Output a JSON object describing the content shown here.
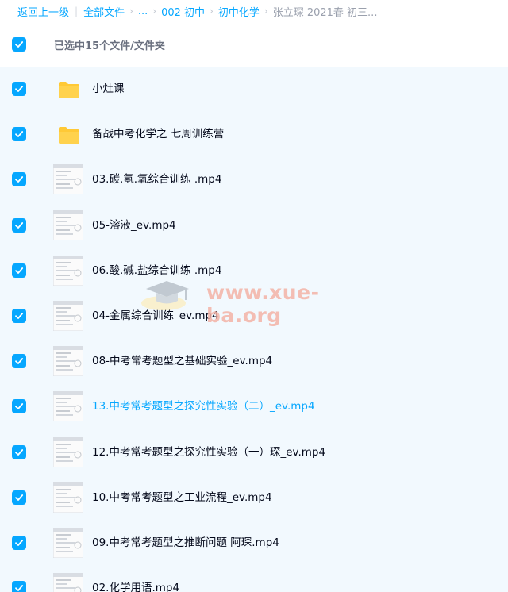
{
  "breadcrumb": {
    "back": "返回上一级",
    "all_files": "全部文件",
    "ellipsis": "...",
    "level1": "002 初中",
    "level2": "初中化学",
    "current": "张立琛 2021春 初三..."
  },
  "selection": {
    "label": "已选中15个文件/文件夹"
  },
  "watermark": {
    "text": "www.xue-ba.org"
  },
  "colors": {
    "accent": "#06a7ff",
    "list_bg": "#f2f9fe",
    "folder": "#ffc936"
  },
  "files": [
    {
      "name": "小灶课",
      "type": "folder",
      "checked": true
    },
    {
      "name": "备战中考化学之 七周训练营",
      "type": "folder",
      "checked": true
    },
    {
      "name": "03.碳.氢.氧综合训练 .mp4",
      "type": "video",
      "checked": true
    },
    {
      "name": "05-溶液_ev.mp4",
      "type": "video",
      "checked": true
    },
    {
      "name": "06.酸.碱.盐综合训练 .mp4",
      "type": "video",
      "checked": true
    },
    {
      "name": "04-金属综合训练_ev.mp4",
      "type": "video",
      "checked": true
    },
    {
      "name": "08-中考常考题型之基础实验_ev.mp4",
      "type": "video",
      "checked": true
    },
    {
      "name": "13.中考常考题型之探究性实验（二）_ev.mp4",
      "type": "video",
      "checked": true,
      "highlighted": true
    },
    {
      "name": "12.中考常考题型之探究性实验（一）琛_ev.mp4",
      "type": "video",
      "checked": true
    },
    {
      "name": "10.中考常考题型之工业流程_ev.mp4",
      "type": "video",
      "checked": true
    },
    {
      "name": "09.中考常考题型之推断问题 阿琛.mp4",
      "type": "video",
      "checked": true
    },
    {
      "name": "02.化学用语.mp4",
      "type": "video",
      "checked": true
    }
  ]
}
